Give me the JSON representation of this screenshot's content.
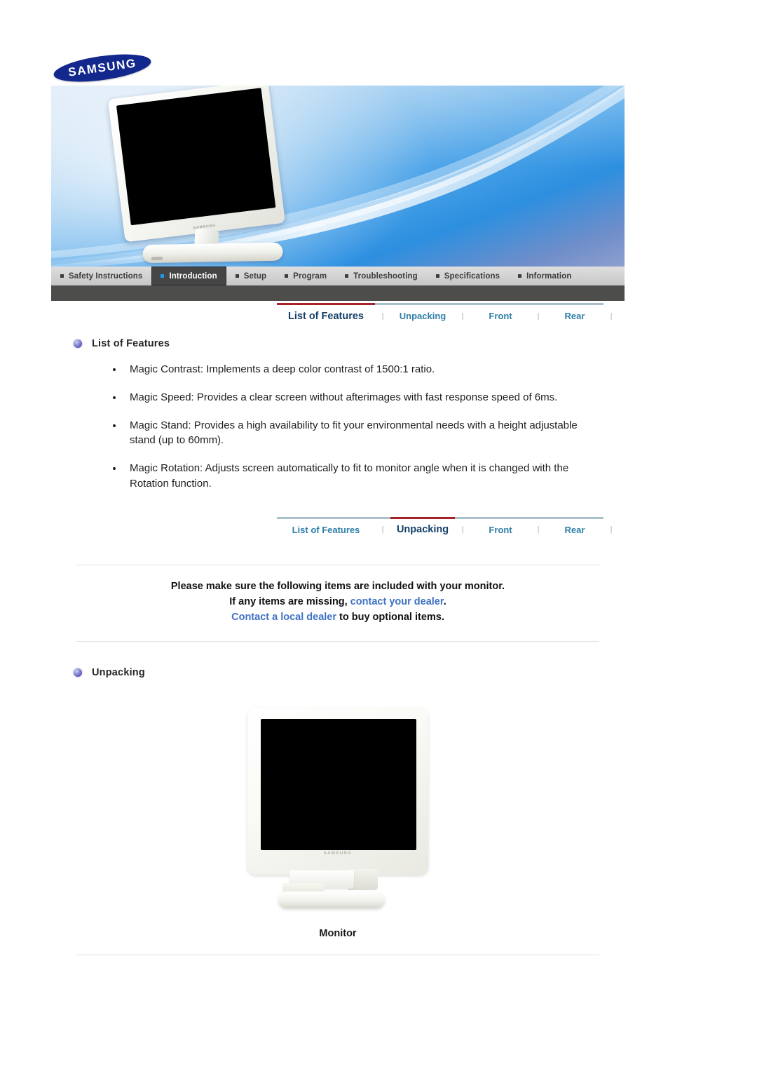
{
  "brand": {
    "logo_text": "SAMSUNG",
    "logo_color": "#13288c"
  },
  "main_nav": {
    "items": [
      {
        "label": "Safety Instructions",
        "active": false
      },
      {
        "label": "Introduction",
        "active": true
      },
      {
        "label": "Setup",
        "active": false
      },
      {
        "label": "Program",
        "active": false
      },
      {
        "label": "Troubleshooting",
        "active": false
      },
      {
        "label": "Specifications",
        "active": false
      },
      {
        "label": "Information",
        "active": false
      }
    ],
    "active_bullet_color": "#1b9bf0"
  },
  "tabstrip_features": {
    "separator": "|",
    "active_border_color": "#a82028",
    "tabs": [
      {
        "label": "List of Features",
        "active": true
      },
      {
        "label": "Unpacking",
        "active": false
      },
      {
        "label": "Front",
        "active": false
      },
      {
        "label": "Rear",
        "active": false
      }
    ]
  },
  "tabstrip_unpacking": {
    "separator": "|",
    "active_border_color": "#a82028",
    "tabs": [
      {
        "label": "List of Features",
        "active": false
      },
      {
        "label": "Unpacking",
        "active": true
      },
      {
        "label": "Front",
        "active": false
      },
      {
        "label": "Rear",
        "active": false
      }
    ]
  },
  "features_section": {
    "title": "List of Features",
    "items": [
      "Magic Contrast: Implements a deep color contrast of 1500:1 ratio.",
      "Magic Speed: Provides a clear screen without afterimages with fast response speed of 6ms.",
      "Magic Stand: Provides a high availability to fit your environmental needs with a height adjustable stand (up to 60mm).",
      "Magic Rotation: Adjusts screen automatically to fit to monitor angle when it is changed with the Rotation function."
    ]
  },
  "notice": {
    "line1": "Please make sure the following items are included with your monitor.",
    "line2_prefix": "If any items are missing, ",
    "line2_link": "contact your dealer",
    "line2_suffix": ".",
    "line3_link": "Contact a local dealer",
    "line3_suffix": " to buy optional items.",
    "link_color": "#3f72c4"
  },
  "unpacking_section": {
    "title": "Unpacking",
    "figure_caption": "Monitor",
    "monitor_brand": "SAMSUNG"
  },
  "hero": {
    "monitor_brand": "SAMSUNG"
  }
}
